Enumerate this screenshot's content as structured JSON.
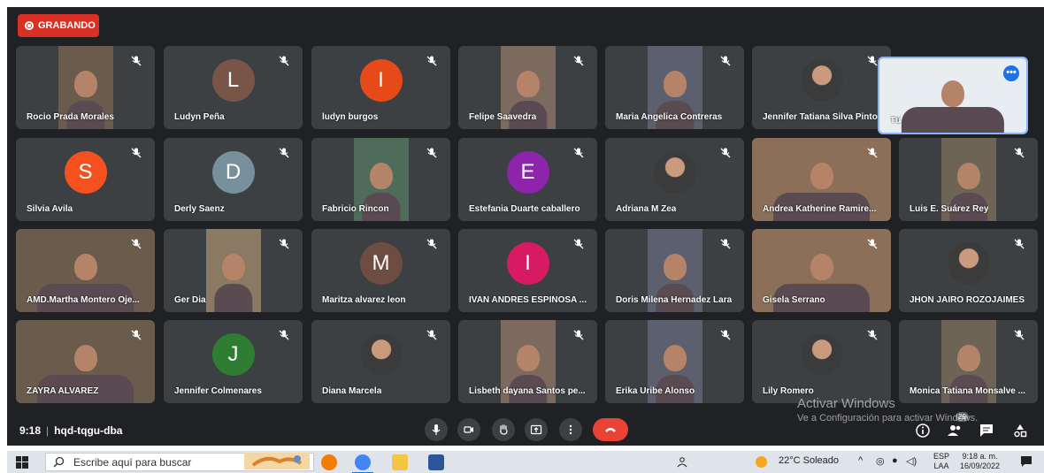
{
  "meet": {
    "recording_label": "GRABANDO",
    "time": "9:18",
    "meeting_code": "hqd-tqgu-dba",
    "participants_count": "29",
    "tiles": [
      {
        "name": "Rocio Prada Morales",
        "type": "video"
      },
      {
        "name": "Ludyn Peña",
        "type": "avatar",
        "letter": "L",
        "color": "#795548"
      },
      {
        "name": "ludyn burgos",
        "type": "avatar",
        "letter": "I",
        "color": "#e64a19"
      },
      {
        "name": "Felipe Saavedra",
        "type": "video"
      },
      {
        "name": "Maria Angelica Contreras",
        "type": "video"
      },
      {
        "name": "Jennifer Tatiana Silva Pinto",
        "type": "photo"
      },
      {
        "name": "Tú",
        "type": "self"
      },
      {
        "name": "Silvia Avila",
        "type": "avatar",
        "letter": "S",
        "color": "#f4511e"
      },
      {
        "name": "Derly Saenz",
        "type": "avatar",
        "letter": "D",
        "color": "#78909c"
      },
      {
        "name": "Fabricio Rincon",
        "type": "video"
      },
      {
        "name": "Estefania Duarte caballero",
        "type": "avatar",
        "letter": "E",
        "color": "#8e24aa"
      },
      {
        "name": "Adriana M Zea",
        "type": "photo"
      },
      {
        "name": "Andrea Katherine Ramire...",
        "type": "video"
      },
      {
        "name": "Luis E. Suárez Rey",
        "type": "video"
      },
      {
        "name": "AMD.Martha Montero Oje...",
        "type": "video"
      },
      {
        "name": "Ger Dia",
        "type": "video"
      },
      {
        "name": "Maritza alvarez leon",
        "type": "avatar",
        "letter": "M",
        "color": "#6d4c41"
      },
      {
        "name": "IVAN ANDRES ESPINOSA ...",
        "type": "avatar",
        "letter": "I",
        "color": "#d81b60"
      },
      {
        "name": "Doris Milena Hernadez Lara",
        "type": "video"
      },
      {
        "name": "Gisela Serrano",
        "type": "video"
      },
      {
        "name": "JHON JAIRO ROZOJAIMES",
        "type": "photo"
      },
      {
        "name": "ZAYRA ALVAREZ",
        "type": "video"
      },
      {
        "name": "Jennifer Colmenares",
        "type": "avatar",
        "letter": "J",
        "color": "#2e7d32"
      },
      {
        "name": "Diana Marcela",
        "type": "photo"
      },
      {
        "name": "Lisbeth dayana Santos pe...",
        "type": "video"
      },
      {
        "name": "Erika Uribe Alonso",
        "type": "video"
      },
      {
        "name": "Lily Romero",
        "type": "photo"
      },
      {
        "name": "Monica Tatiana Monsalve ...",
        "type": "video"
      }
    ],
    "watermark_title": "Activar Windows",
    "watermark_sub": "Ve a Configuración para activar Windows."
  },
  "taskbar": {
    "search_placeholder": "Escribe aquí para buscar",
    "weather": "22°C  Soleado",
    "lang_top": "ESP",
    "lang_bottom": "LAA",
    "clock_time": "9:18 a. m.",
    "clock_date": "16/09/2022"
  }
}
